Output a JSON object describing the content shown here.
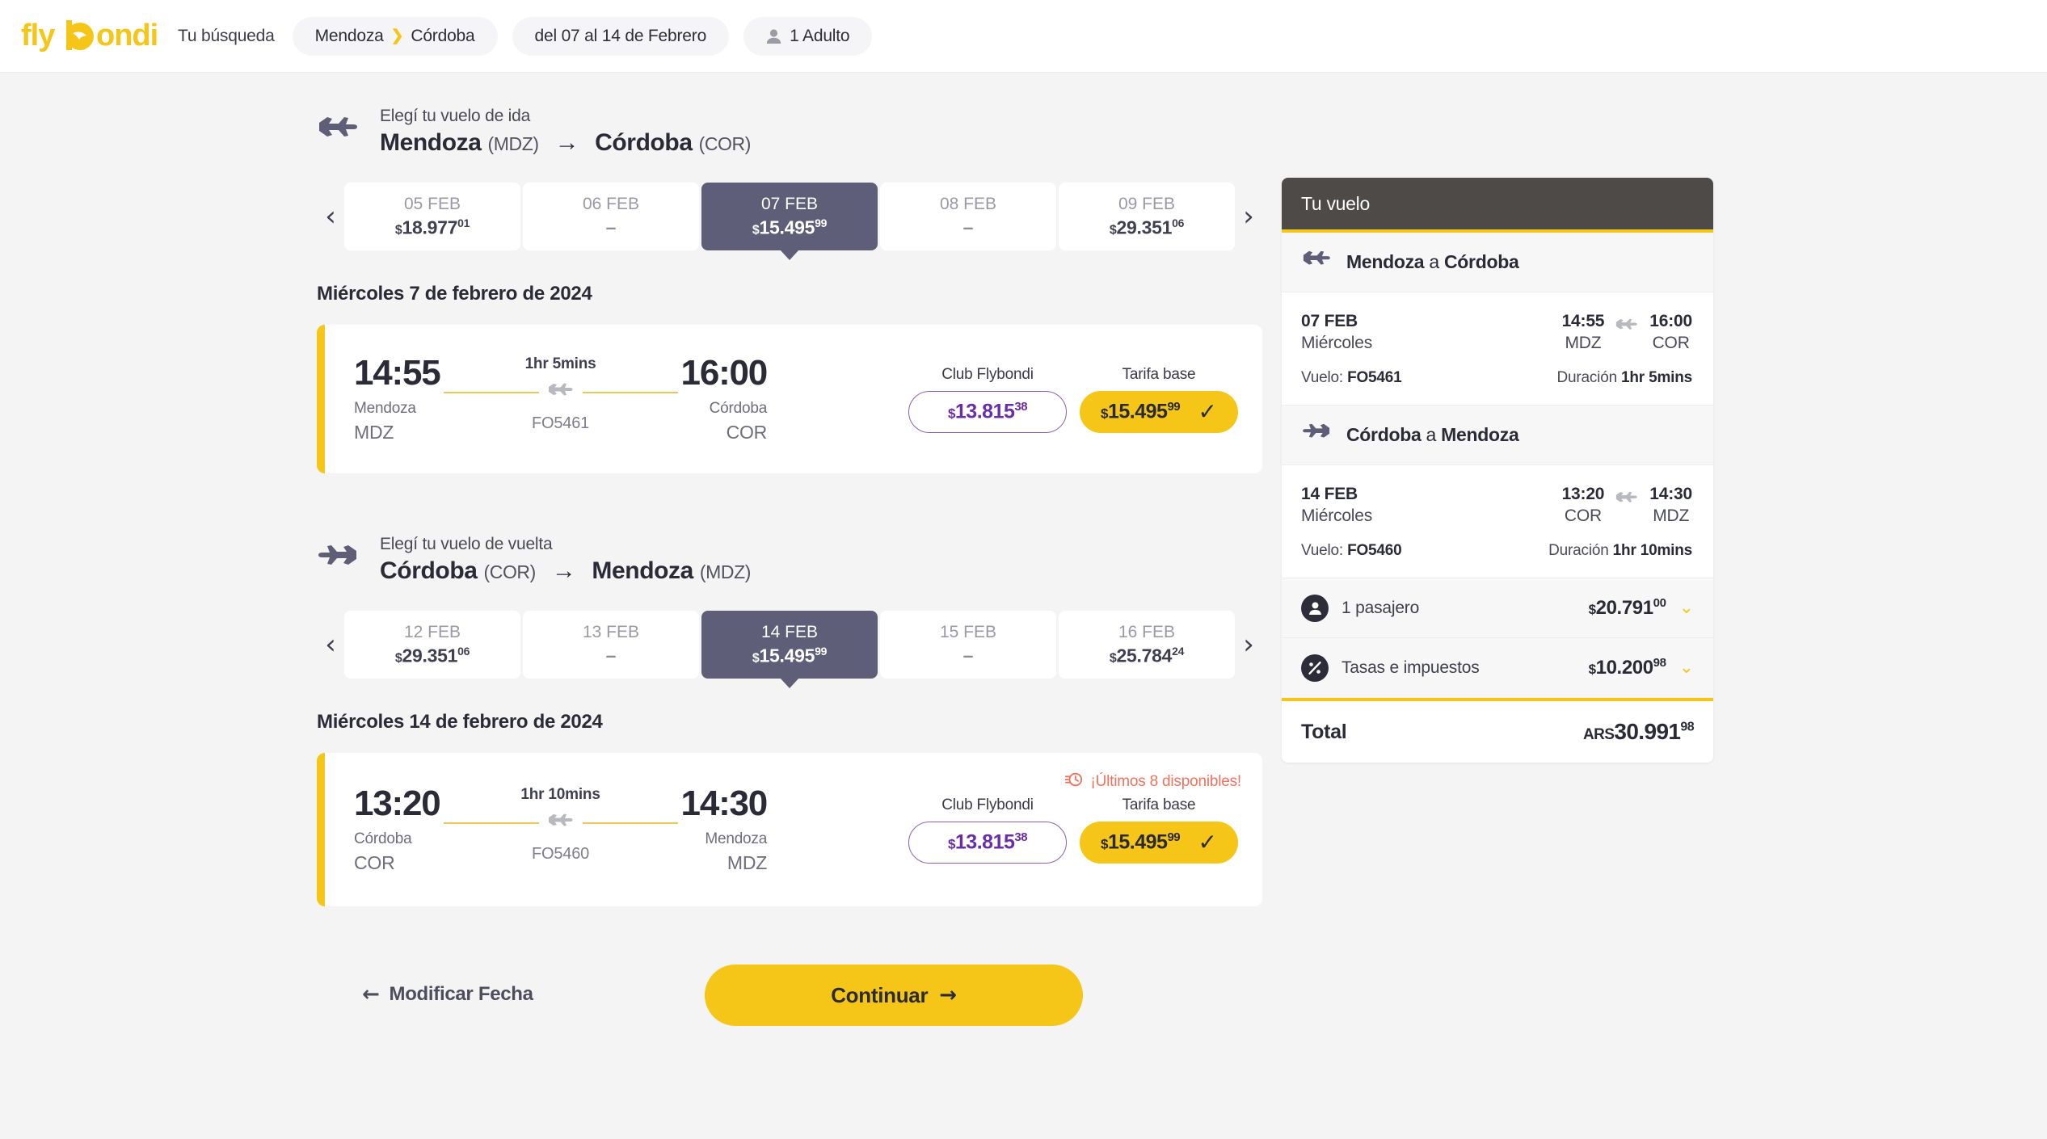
{
  "brand": {
    "name": "flybondi",
    "logo_color": "#F5C518"
  },
  "topbar": {
    "search_label": "Tu búsqueda",
    "route_chip": {
      "origin": "Mendoza",
      "arrow": "❯",
      "destination": "Córdoba"
    },
    "dates_chip": "del 07 al 14 de Febrero",
    "pax_chip": "1 Adulto"
  },
  "outbound": {
    "kicker": "Elegí tu vuelo de ida",
    "origin_city": "Mendoza",
    "origin_code": "(MDZ)",
    "sep": "→",
    "dest_city": "Córdoba",
    "dest_code": "(COR)",
    "dates": [
      {
        "day": "05 FEB",
        "currency": "$",
        "price": "18.977",
        "cents": "01",
        "selected": false,
        "empty": false
      },
      {
        "day": "06 FEB",
        "currency": "",
        "price": "–",
        "cents": "",
        "selected": false,
        "empty": true
      },
      {
        "day": "07 FEB",
        "currency": "$",
        "price": "15.495",
        "cents": "99",
        "selected": true,
        "empty": false
      },
      {
        "day": "08 FEB",
        "currency": "",
        "price": "–",
        "cents": "",
        "selected": false,
        "empty": true
      },
      {
        "day": "09 FEB",
        "currency": "$",
        "price": "29.351",
        "cents": "06",
        "selected": false,
        "empty": false
      }
    ],
    "day_label": "Miércoles 7 de febrero de 2024",
    "flight": {
      "dep_time": "14:55",
      "dep_city": "Mendoza",
      "dep_code": "MDZ",
      "duration": "1hr 5mins",
      "flight_no": "FO5461",
      "arr_time": "16:00",
      "arr_city": "Córdoba",
      "arr_code": "COR",
      "club_label": "Club Flybondi",
      "club_currency": "$",
      "club_price": "13.815",
      "club_cents": "38",
      "base_label": "Tarifa base",
      "base_currency": "$",
      "base_price": "15.495",
      "base_cents": "99",
      "base_selected": true,
      "last_seats": ""
    }
  },
  "inbound": {
    "kicker": "Elegí tu vuelo de vuelta",
    "origin_city": "Córdoba",
    "origin_code": "(COR)",
    "sep": "→",
    "dest_city": "Mendoza",
    "dest_code": "(MDZ)",
    "dates": [
      {
        "day": "12 FEB",
        "currency": "$",
        "price": "29.351",
        "cents": "06",
        "selected": false,
        "empty": false
      },
      {
        "day": "13 FEB",
        "currency": "",
        "price": "–",
        "cents": "",
        "selected": false,
        "empty": true
      },
      {
        "day": "14 FEB",
        "currency": "$",
        "price": "15.495",
        "cents": "99",
        "selected": true,
        "empty": false
      },
      {
        "day": "15 FEB",
        "currency": "",
        "price": "–",
        "cents": "",
        "selected": false,
        "empty": true
      },
      {
        "day": "16 FEB",
        "currency": "$",
        "price": "25.784",
        "cents": "24",
        "selected": false,
        "empty": false
      }
    ],
    "day_label": "Miércoles 14 de febrero de 2024",
    "flight": {
      "dep_time": "13:20",
      "dep_city": "Córdoba",
      "dep_code": "COR",
      "duration": "1hr 10mins",
      "flight_no": "FO5460",
      "arr_time": "14:30",
      "arr_city": "Mendoza",
      "arr_code": "MDZ",
      "club_label": "Club Flybondi",
      "club_currency": "$",
      "club_price": "13.815",
      "club_cents": "38",
      "base_label": "Tarifa base",
      "base_currency": "$",
      "base_price": "15.495",
      "base_cents": "99",
      "base_selected": true,
      "last_seats": "¡Últimos 8 disponibles!"
    }
  },
  "actions": {
    "modify_arrow": "←",
    "modify_label": "Modificar Fecha",
    "continue_label": "Continuar",
    "continue_arrow": "→"
  },
  "summary": {
    "title": "Tu vuelo",
    "leg1": {
      "route_from": "Mendoza",
      "route_joiner": "a",
      "route_to": "Córdoba",
      "date": "07 FEB",
      "weekday": "Miércoles",
      "dep_time": "14:55",
      "dep_code": "MDZ",
      "arr_time": "16:00",
      "arr_code": "COR",
      "flight_label": "Vuelo:",
      "flight_no": "FO5461",
      "dur_label": "Duración",
      "duration": "1hr 5mins"
    },
    "leg2": {
      "route_from": "Córdoba",
      "route_joiner": "a",
      "route_to": "Mendoza",
      "date": "14 FEB",
      "weekday": "Miércoles",
      "dep_time": "13:20",
      "dep_code": "COR",
      "arr_time": "14:30",
      "arr_code": "MDZ",
      "flight_label": "Vuelo:",
      "flight_no": "FO5460",
      "dur_label": "Duración",
      "duration": "1hr 10mins"
    },
    "pax_row": {
      "label": "1 pasajero",
      "currency": "$",
      "value": "20.791",
      "cents": "00"
    },
    "tax_row": {
      "label": "Tasas e impuestos",
      "currency": "$",
      "value": "10.200",
      "cents": "98"
    },
    "total_row": {
      "label": "Total",
      "currency": "ARS",
      "value": "30.991",
      "cents": "98"
    }
  },
  "colors": {
    "brand_yellow": "#F5C518",
    "selected_date": "#5E5E78",
    "club_purple": "#6A2DA8",
    "panel_header": "#4D4A47",
    "alert_red": "#F0725E",
    "page_bg": "#F4F4F4"
  }
}
